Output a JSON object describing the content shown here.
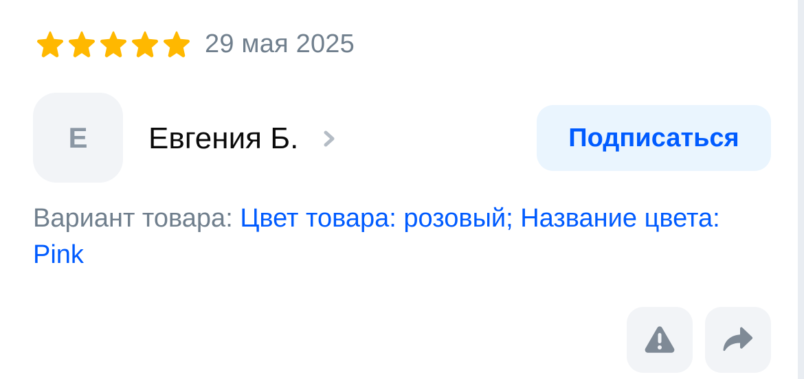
{
  "review": {
    "rating": 5,
    "rating_max": 5,
    "date": "29 мая 2025"
  },
  "author": {
    "initial": "Е",
    "name": "Евгения Б."
  },
  "actions": {
    "subscribe_label": "Подписаться",
    "report_icon": "warning-triangle-icon",
    "share_icon": "share-arrow-icon"
  },
  "variant": {
    "label": "Вариант товара: ",
    "value": "Цвет товара: розовый; Название цвета: Pink"
  },
  "colors": {
    "star": "#ffb800",
    "accent": "#005bff",
    "muted_text": "#707f8d",
    "button_bg": "#eaf5fe",
    "icon_bg": "#f2f4f7",
    "icon_fg": "#7f8a96"
  }
}
